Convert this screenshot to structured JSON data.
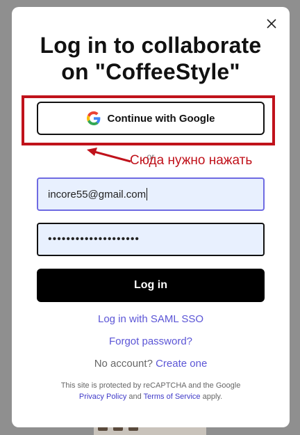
{
  "modal": {
    "title_line1": "Log in to collaborate",
    "title_line2": "on \"CoffeeStyle\"",
    "close_icon": "close-icon"
  },
  "google": {
    "label": "Continue with Google",
    "icon": "google-g-icon"
  },
  "divider": {
    "or_text": "or"
  },
  "annotation": {
    "text": "Сюда нужно нажать",
    "color": "#c0121b"
  },
  "form": {
    "email_value": "incore55@gmail.com",
    "password_mask": "••••••••••••••••••••",
    "login_label": "Log in"
  },
  "links": {
    "saml": "Log in with SAML SSO",
    "forgot": "Forgot password?",
    "no_account": "No account?",
    "create": "Create one"
  },
  "legal": {
    "line1": "This site is protected by reCAPTCHA and the Google",
    "privacy": "Privacy Policy",
    "and": "and",
    "terms": "Terms of Service",
    "apply": "apply."
  },
  "colors": {
    "accent": "#5b55d6",
    "email_border": "#6e6ae2",
    "field_bg": "#e8f0fe",
    "button_bg": "#000000"
  }
}
